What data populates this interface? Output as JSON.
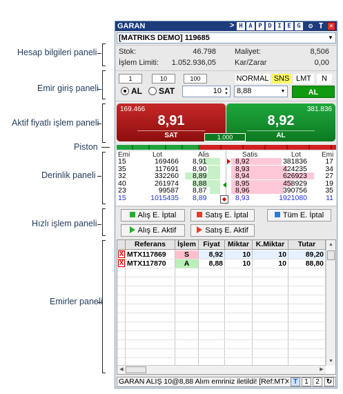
{
  "annotations": {
    "account": "Hesap bilgileri paneli",
    "order_entry": "Emir giriş paneli",
    "active_price": "Aktif fiyatlı işlem paneli",
    "piston": "Piston",
    "depth": "Derinlik paneli",
    "quick_trade": "Hızlı işlem paneli",
    "orders": "Emirler paneli"
  },
  "titlebar": {
    "symbol": "GARAN",
    "arrow": ">",
    "buttons": [
      "H",
      "A",
      "P",
      "D",
      "I",
      "E",
      "G"
    ],
    "extra": [
      "⚙",
      "T",
      "✕"
    ]
  },
  "account": {
    "selected": "[MATRIKS DEMO] 119685"
  },
  "info": {
    "stok_label": "Stok:",
    "stok_value": "46.798",
    "limit_label": "İşlem Limiti:",
    "limit_value": "1.052.936,05",
    "maliyet_label": "Maliyet:",
    "maliyet_value": "8,506",
    "karzarar_label": "Kar/Zarar",
    "karzarar_value": "0,00"
  },
  "order_entry": {
    "qty_presets": [
      "1",
      "10",
      "100"
    ],
    "modes": [
      "NORMAL",
      "SNS",
      "LMT",
      "N"
    ],
    "selected_mode": "SNS",
    "side_buy": "AL",
    "side_sell": "SAT",
    "quantity": "10",
    "price": "8,88",
    "submit": "AL",
    "colors": {
      "submit_bg": "#0f9a0f",
      "sns_bg": "#ffff66"
    }
  },
  "active_price": {
    "sell_volume": "169.466",
    "sell_price": "8,91",
    "sell_label": "SAT",
    "buy_volume": "381.836",
    "buy_price": "8,92",
    "buy_label": "AL",
    "lot": "1.000"
  },
  "depth": {
    "headers": [
      "Emi",
      "Lot",
      "Alis",
      "Satis",
      "Lot",
      "Emi"
    ],
    "rows": [
      {
        "bid_emi": "15",
        "bid_lot": "169466",
        "bid": "8,91",
        "ask": "8,92",
        "ask_lot": "381836",
        "ask_emi": "17",
        "bid_fill": 0.26,
        "ask_fill": 0.52
      },
      {
        "bid_emi": "35",
        "bid_lot": "117691",
        "bid": "8,90",
        "ask": "8,93",
        "ask_lot": "424235",
        "ask_emi": "34",
        "bid_fill": 0.18,
        "ask_fill": 0.58
      },
      {
        "bid_emi": "32",
        "bid_lot": "332260",
        "bid": "8,89",
        "ask": "8,94",
        "ask_lot": "626923",
        "ask_emi": "27",
        "bid_fill": 0.51,
        "ask_fill": 0.86
      },
      {
        "bid_emi": "40",
        "bid_lot": "261974",
        "bid": "8,88",
        "ask": "8,95",
        "ask_lot": "458929",
        "ask_emi": "19",
        "bid_fill": 0.4,
        "ask_fill": 0.63
      },
      {
        "bid_emi": "23",
        "bid_lot": "99587",
        "bid": "8,87",
        "ask": "8,96",
        "ask_lot": "390756",
        "ask_emi": "35",
        "bid_fill": 0.15,
        "ask_fill": 0.54
      }
    ],
    "totals": {
      "bid_emi": "15",
      "bid_lot": "1015435",
      "bid": "8,89",
      "ask": "8,93",
      "ask_lot": "1921080",
      "ask_emi": "11"
    }
  },
  "quick_trade": {
    "buttons": [
      "Alış E. İptal",
      "Satış E. İptal",
      "Tüm E. İptal",
      "Alış E. Aktif",
      "Satış E. Aktif"
    ]
  },
  "orders": {
    "headers": [
      "Referans",
      "İşlem",
      "Fiyat",
      "Miktar",
      "K.Miktar",
      "Tutar"
    ],
    "rows": [
      {
        "ref": "MTX117869",
        "side": "S",
        "price": "8,92",
        "qty": "10",
        "kqty": "10",
        "amount": "89,20",
        "side_color": "#ffc0cb"
      },
      {
        "ref": "MTX117870",
        "side": "A",
        "price": "8,88",
        "qty": "10",
        "kqty": "10",
        "amount": "88,80",
        "side_color": "#b8f0b8"
      }
    ]
  },
  "status": {
    "message": "GARAN ALIŞ 10@8,88 Alım emriniz iletildi! [Ref:MTX",
    "buttons": [
      "T",
      "1",
      "2",
      "↻"
    ]
  }
}
